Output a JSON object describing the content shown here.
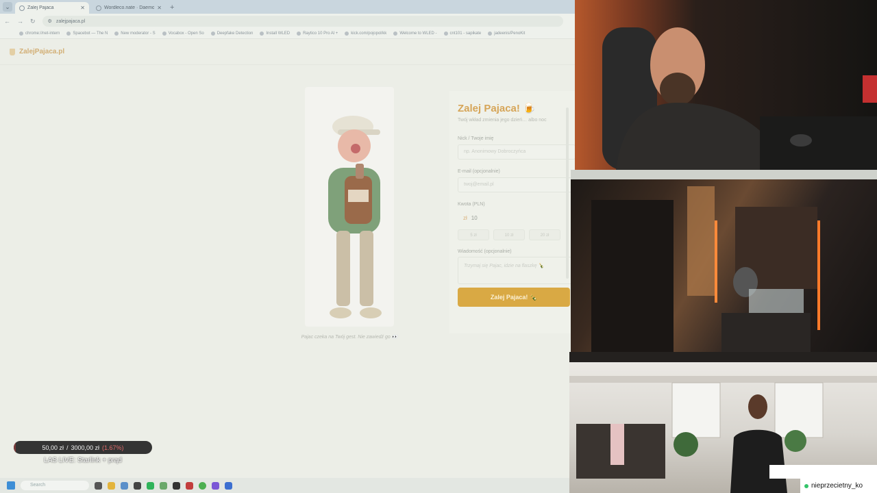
{
  "browser": {
    "tabs": [
      {
        "label": "Zalej Pajaca",
        "active": true
      },
      {
        "label": "Wordleco.nate · Daemon Penc",
        "active": false
      }
    ],
    "url": "zalejpajaca.pl",
    "bookmarks": [
      "chrome://net-intern",
      "Spacebot — The N",
      "New moderator - S",
      "Vocabox - Open So",
      "Deepfake Detection",
      "Install WLED",
      "Raytico 10 Pro Al +",
      "kick.com/pojopol/kk",
      "Welcome to WLED -",
      "cnt101 - sapikate",
      "jadeenis/PenoKit"
    ]
  },
  "site": {
    "logo": "ZalejPajaca.pl",
    "caption": "Pajac czeka na Twój gest. Nie zawiedź go 👀",
    "form": {
      "title": "Zalej Pajaca! 🍺",
      "subtitle": "Twój wkład zmienia jego dzień… albo noc",
      "nick_label": "Nick / Twoje imię",
      "nick_placeholder": "np. Anonimowy Dobroczyńca",
      "email_label": "E-mail (opcjonalnie)",
      "email_placeholder": "twoj@email.pl",
      "amount_label": "Kwota (PLN)",
      "currency": "zł",
      "amount_value": "10",
      "presets": [
        "5 zł",
        "10 zł",
        "20 zł"
      ],
      "message_label": "Wiadomość (opcjonalnie)",
      "message_placeholder": "Trzymaj się Pajac, idzie na flaszkę 🍾",
      "submit_label": "Zalej Pajaca! 🍾"
    }
  },
  "overlay": {
    "goal_current": "50,00 zł",
    "goal_separator": "/",
    "goal_target": "3000,00 zł",
    "goal_percent": "(1.67%)",
    "goal_progress": 0.0167,
    "live_title": "LAS LIVE: Starlink + prąd"
  },
  "taskbar": {
    "search_placeholder": "Search"
  },
  "streamer": {
    "name": "nieprzecietny_ko"
  }
}
